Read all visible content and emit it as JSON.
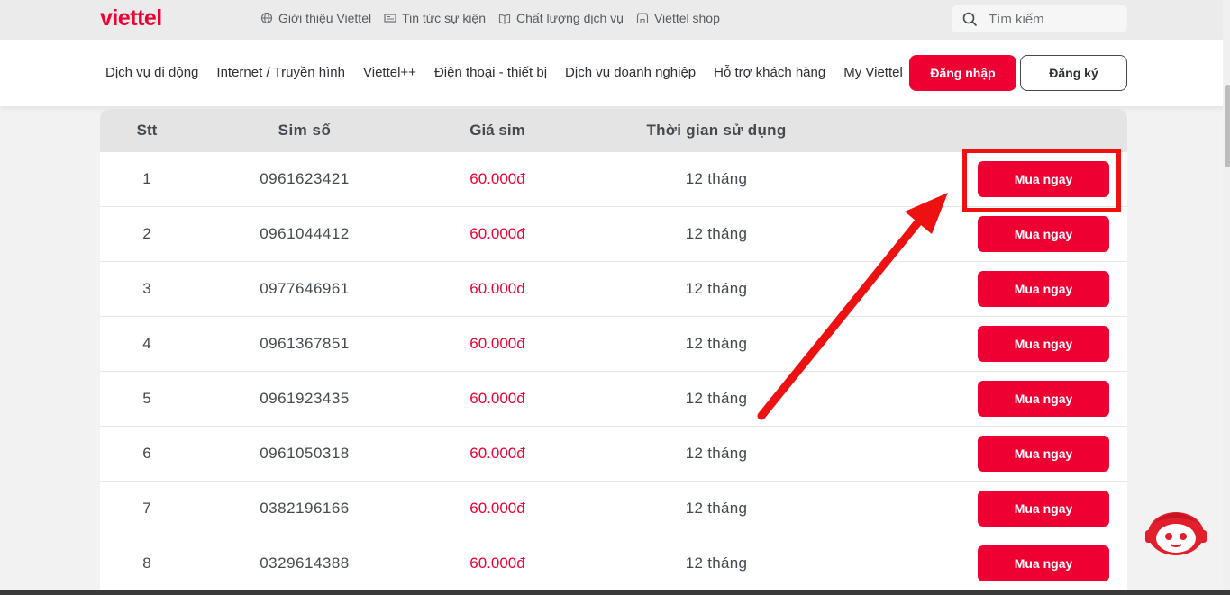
{
  "brand": {
    "logo_text": "viettel",
    "accent": "#ee0033"
  },
  "topbar": {
    "items": [
      {
        "label": "Giới thiệu Viettel",
        "icon": "globe-icon"
      },
      {
        "label": "Tin tức sự kiện",
        "icon": "newspaper-icon"
      },
      {
        "label": "Chất lượng dịch vụ",
        "icon": "book-icon"
      },
      {
        "label": "Viettel shop",
        "icon": "store-icon"
      }
    ],
    "search_placeholder": "Tìm kiếm"
  },
  "nav": {
    "items": [
      "Dịch vụ di động",
      "Internet / Truyền hình",
      "Viettel++",
      "Điện thoại - thiết bị",
      "Dịch vụ doanh nghiệp",
      "Hỗ trợ khách hàng",
      "My Viettel"
    ],
    "login": "Đăng nhập",
    "register": "Đăng ký"
  },
  "table": {
    "headers": {
      "stt": "Stt",
      "sim": "Sim số",
      "price": "Giá sim",
      "duration": "Thời gian sử dụng"
    },
    "buy_label": "Mua ngay",
    "rows": [
      {
        "stt": "1",
        "sim": "0961623421",
        "price": "60.000đ",
        "duration": "12 tháng"
      },
      {
        "stt": "2",
        "sim": "0961044412",
        "price": "60.000đ",
        "duration": "12 tháng"
      },
      {
        "stt": "3",
        "sim": "0977646961",
        "price": "60.000đ",
        "duration": "12 tháng"
      },
      {
        "stt": "4",
        "sim": "0961367851",
        "price": "60.000đ",
        "duration": "12 tháng"
      },
      {
        "stt": "5",
        "sim": "0961923435",
        "price": "60.000đ",
        "duration": "12 tháng"
      },
      {
        "stt": "6",
        "sim": "0961050318",
        "price": "60.000đ",
        "duration": "12 tháng"
      },
      {
        "stt": "7",
        "sim": "0382196166",
        "price": "60.000đ",
        "duration": "12 tháng"
      },
      {
        "stt": "8",
        "sim": "0329614388",
        "price": "60.000đ",
        "duration": "12 tháng"
      }
    ]
  },
  "annotation": {
    "color": "#ee1111",
    "target": "buy-button-row-1"
  }
}
